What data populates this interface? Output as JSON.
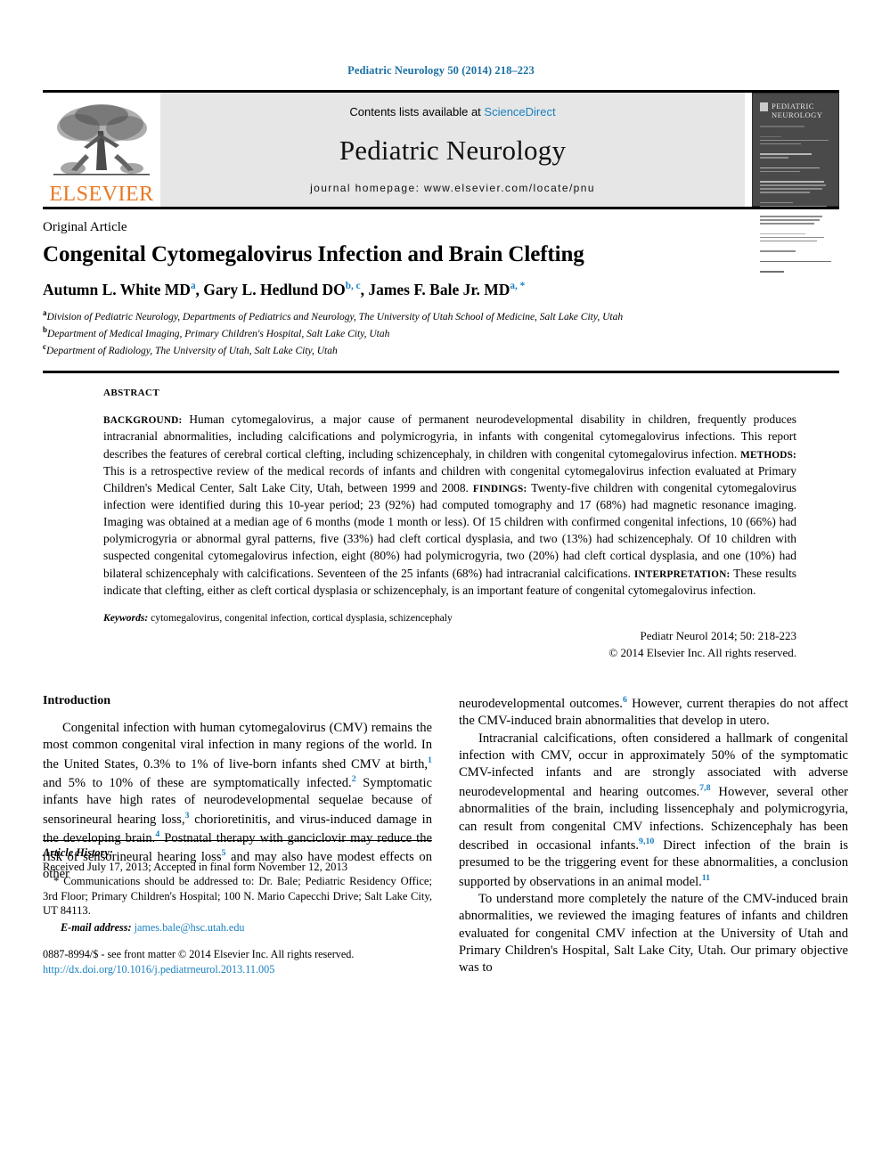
{
  "running_head": "Pediatric Neurology 50 (2014) 218–223",
  "banner": {
    "publisher_name": "ELSEVIER",
    "contents_prefix": "Contents lists available at ",
    "contents_link": "ScienceDirect",
    "journal_name": "Pediatric Neurology",
    "homepage_label": "journal homepage: www.elsevier.com/locate/pnu",
    "cover_title_line1": "PEDIATRIC",
    "cover_title_line2": "NEUROLOGY"
  },
  "article": {
    "type": "Original Article",
    "title": "Congenital Cytomegalovirus Infection and Brain Clefting",
    "authors": [
      {
        "name": "Autumn L. White MD",
        "marks": "a",
        "sep": ", "
      },
      {
        "name": "Gary L. Hedlund DO",
        "marks": "b, c",
        "sep": ", "
      },
      {
        "name": "James F. Bale Jr. MD",
        "marks": "a, *",
        "sep": ""
      }
    ],
    "affiliations": [
      {
        "mark": "a",
        "text": "Division of Pediatric Neurology, Departments of Pediatrics and Neurology, The University of Utah School of Medicine, Salt Lake City, Utah"
      },
      {
        "mark": "b",
        "text": "Department of Medical Imaging, Primary Children's Hospital, Salt Lake City, Utah"
      },
      {
        "mark": "c",
        "text": "Department of Radiology, The University of Utah, Salt Lake City, Utah"
      }
    ]
  },
  "abstract": {
    "label": "ABSTRACT",
    "sections": [
      {
        "heading": "BACKGROUND:",
        "text": " Human cytomegalovirus, a major cause of permanent neurodevelopmental disability in children, frequently produces intracranial abnormalities, including calcifications and polymicrogyria, in infants with congenital cytomegalovirus infections. This report describes the features of cerebral cortical clefting, including schizencephaly, in children with congenital cytomegalovirus infection. "
      },
      {
        "heading": "METHODS:",
        "text": " This is a retrospective review of the medical records of infants and children with congenital cytomegalovirus infection evaluated at Primary Children's Medical Center, Salt Lake City, Utah, between 1999 and 2008. "
      },
      {
        "heading": "FINDINGS:",
        "text": " Twenty-five children with congenital cytomegalovirus infection were identified during this 10-year period; 23 (92%) had computed tomography and 17 (68%) had magnetic resonance imaging. Imaging was obtained at a median age of 6 months (mode 1 month or less). Of 15 children with confirmed congenital infections, 10 (66%) had polymicrogyria or abnormal gyral patterns, five (33%) had cleft cortical dysplasia, and two (13%) had schizencephaly. Of 10 children with suspected congenital cytomegalovirus infection, eight (80%) had polymicrogyria, two (20%) had cleft cortical dysplasia, and one (10%) had bilateral schizencephaly with calcifications. Seventeen of the 25 infants (68%) had intracranial calcifications. "
      },
      {
        "heading": "INTERPRETATION:",
        "text": " These results indicate that clefting, either as cleft cortical dysplasia or schizencephaly, is an important feature of congenital cytomegalovirus infection."
      }
    ],
    "keywords_label": "Keywords:",
    "keywords_value": " cytomegalovirus, congenital infection, cortical dysplasia, schizencephaly",
    "citation": "Pediatr Neurol 2014; 50: 218-223",
    "copyright": "© 2014 Elsevier Inc. All rights reserved."
  },
  "body": {
    "intro_heading": "Introduction",
    "left_paragraphs": [
      {
        "parts": [
          {
            "t": "Congenital infection with human cytomegalovirus (CMV) remains the most common congenital viral infection in many regions of the world. In the United States, 0.3% to 1% of live-born infants shed CMV at birth,"
          },
          {
            "ref": "1"
          },
          {
            "t": " and 5% to 10% of these are symptomatically infected."
          },
          {
            "ref": "2"
          },
          {
            "t": " Symptomatic infants have high rates of neurodevelopmental sequelae because of sensorineural hearing loss,"
          },
          {
            "ref": "3"
          },
          {
            "t": " chorioretinitis, and virus-induced damage in the developing brain."
          },
          {
            "ref": "4"
          },
          {
            "t": " Postnatal therapy with ganciclovir may reduce the risk of sensorineural hearing loss"
          },
          {
            "ref": "5"
          },
          {
            "t": " and may also have modest effects on other"
          }
        ]
      }
    ],
    "right_paragraphs": [
      {
        "indent": false,
        "parts": [
          {
            "t": "neurodevelopmental outcomes."
          },
          {
            "ref": "6"
          },
          {
            "t": " However, current therapies do not affect the CMV-induced brain abnormalities that develop in utero."
          }
        ]
      },
      {
        "indent": true,
        "parts": [
          {
            "t": "Intracranial calcifications, often considered a hallmark of congenital infection with CMV, occur in approximately 50% of the symptomatic CMV-infected infants and are strongly associated with adverse neurodevelopmental and hearing outcomes."
          },
          {
            "ref": "7,8"
          },
          {
            "t": " However, several other abnormalities of the brain, including lissencephaly and polymicrogyria, can result from congenital CMV infections. Schizencephaly has been described in occasional infants."
          },
          {
            "ref": "9,10"
          },
          {
            "t": " Direct infection of the brain is presumed to be the triggering event for these abnormalities, a conclusion supported by observations in an animal model."
          },
          {
            "ref": "11"
          },
          {
            "t": ""
          }
        ]
      },
      {
        "indent": true,
        "parts": [
          {
            "t": "To understand more completely the nature of the CMV-induced brain abnormalities, we reviewed the imaging features of infants and children evaluated for congenital CMV infection at the University of Utah and Primary Children's Hospital, Salt Lake City, Utah. Our primary objective was to"
          }
        ]
      }
    ]
  },
  "footnotes": {
    "history_label": "Article History:",
    "history_text": "Received July 17, 2013; Accepted in final form November 12, 2013",
    "correspondence": "* Communications should be addressed to: Dr. Bale; Pediatric Residency Office; 3rd Floor; Primary Children's Hospital; 100 N. Mario Capecchi Drive; Salt Lake City, UT 84113.",
    "email_label": "E-mail address:",
    "email_value": " james.bale@hsc.utah.edu",
    "issn_line": "0887-8994/$ - see front matter © 2014 Elsevier Inc. All rights reserved.",
    "doi_line": "http://dx.doi.org/10.1016/j.pediatrneurol.2013.11.005"
  },
  "colors": {
    "link_blue": "#1a7fc1",
    "header_blue": "#1a6fa3",
    "elsevier_orange": "#E87722",
    "banner_gray": "#e6e6e6"
  }
}
